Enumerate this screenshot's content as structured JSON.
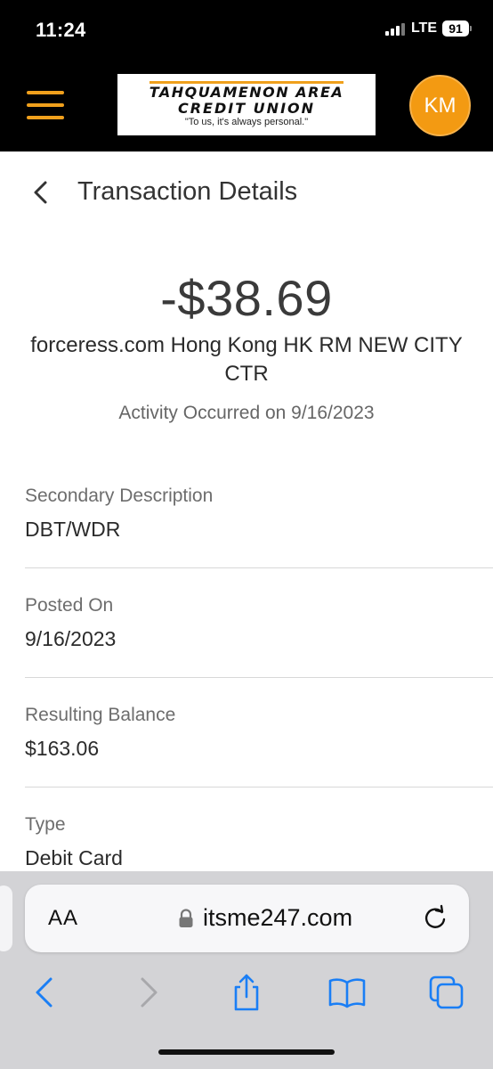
{
  "status_bar": {
    "time": "11:24",
    "network": "LTE",
    "battery": "91"
  },
  "header": {
    "logo_line1": "TAHQUAMENON AREA",
    "logo_line2": "CREDIT UNION",
    "logo_tagline": "\"To us, it's always personal.\"",
    "avatar_initials": "KM"
  },
  "page": {
    "title": "Transaction Details"
  },
  "transaction": {
    "amount": "-$38.69",
    "merchant": "forceress.com Hong Kong HK RM      NEW CITY CTR",
    "occurred": "Activity Occurred on 9/16/2023"
  },
  "details": [
    {
      "label": "Secondary Description",
      "value": "DBT/WDR"
    },
    {
      "label": "Posted On",
      "value": "9/16/2023"
    },
    {
      "label": "Resulting Balance",
      "value": "$163.06"
    },
    {
      "label": "Type",
      "value": "Debit Card"
    }
  ],
  "browser": {
    "aa_label": "AA",
    "url": "itsme247.com"
  },
  "colors": {
    "accent": "#f0a01c",
    "ios_blue": "#1a7ef5",
    "disabled": "#a8a8ab"
  }
}
